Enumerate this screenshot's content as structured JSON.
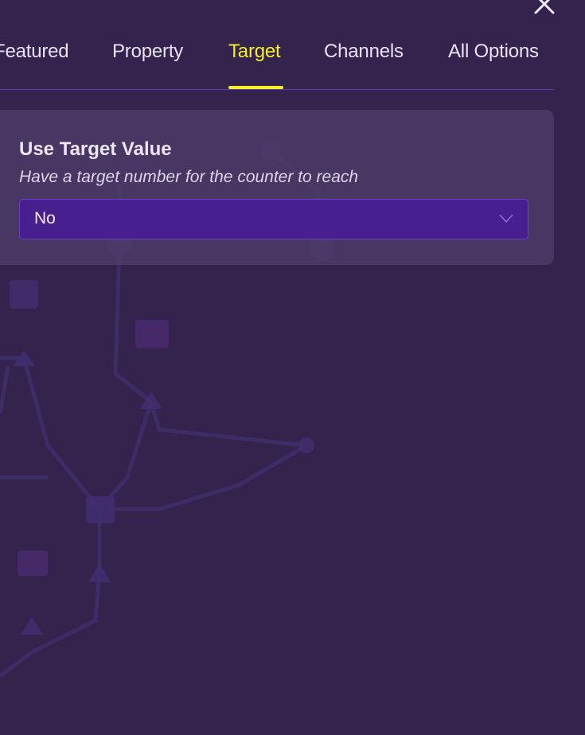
{
  "tabs": [
    {
      "label": "Featured",
      "active": false
    },
    {
      "label": "Property",
      "active": false
    },
    {
      "label": "Target",
      "active": true
    },
    {
      "label": "Channels",
      "active": false
    },
    {
      "label": "All Options",
      "active": false
    }
  ],
  "setting": {
    "title": "Use Target Value",
    "description": "Have a target number for the counter to reach",
    "selected": "No"
  },
  "icons": {
    "close": "close-icon",
    "dropdown": "chevron-down-icon"
  },
  "colors": {
    "background": "#33234d",
    "accent": "#f7ef2a",
    "select_bg": "#471f8e",
    "divider": "#5a3fae"
  }
}
